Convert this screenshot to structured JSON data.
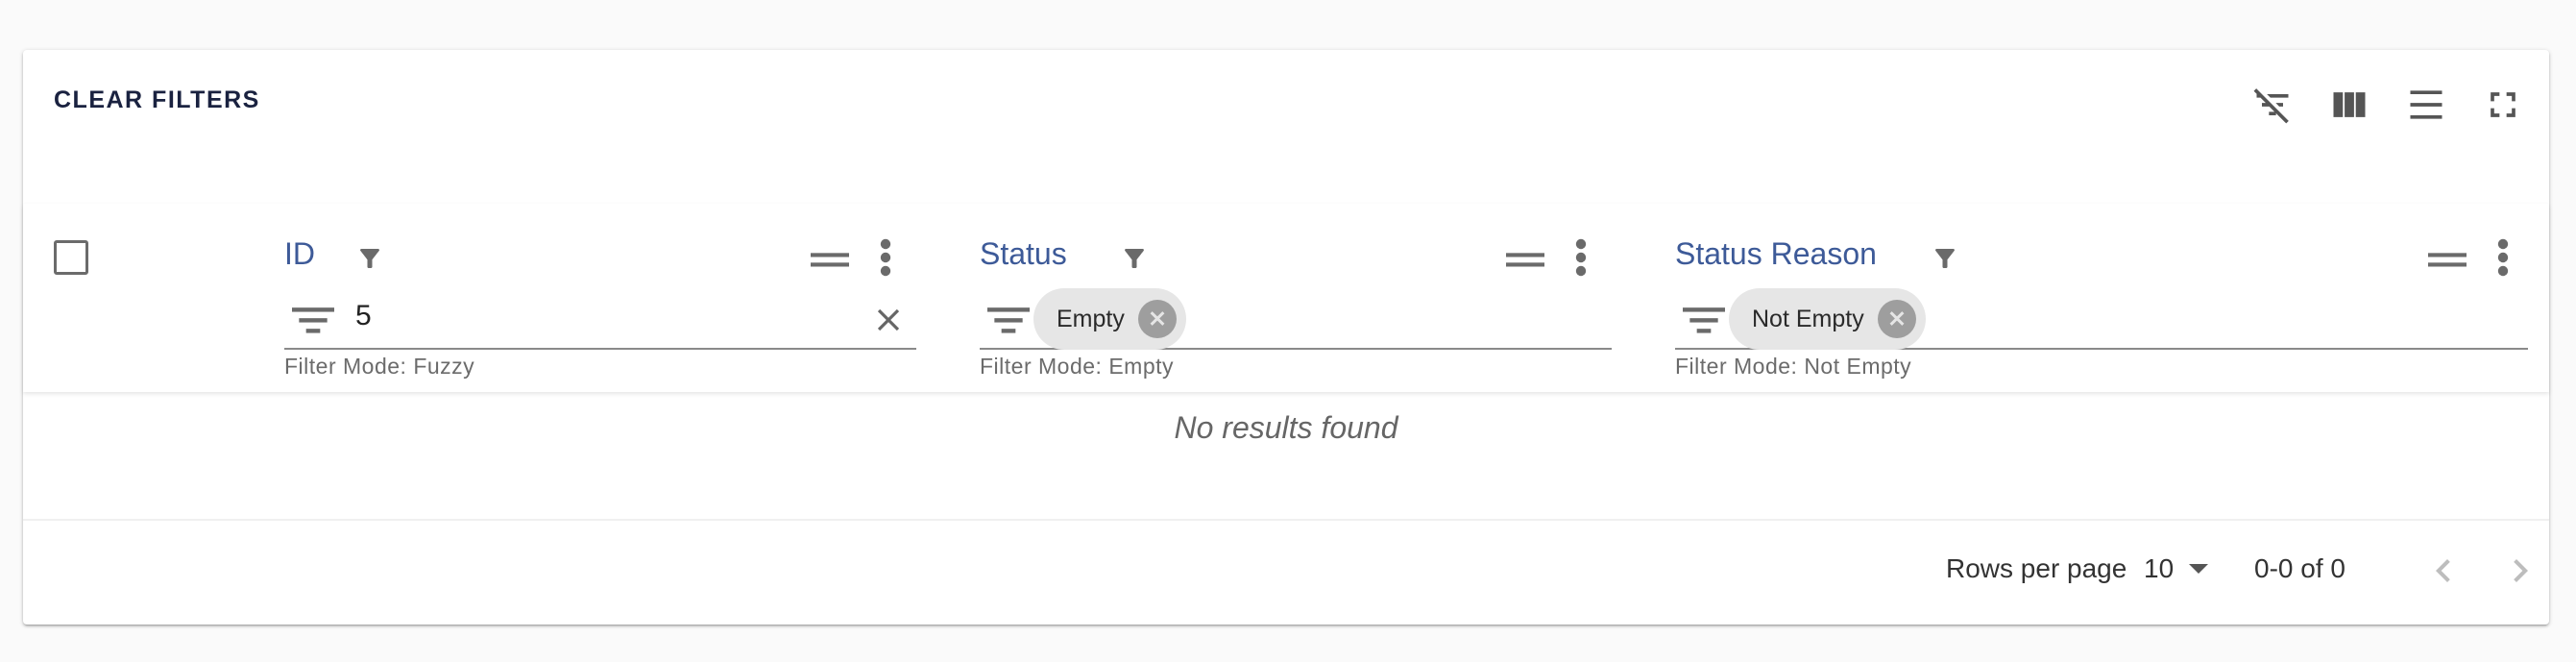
{
  "toolbar": {
    "clear_filters": "CLEAR FILTERS",
    "icons": [
      "filter-off-icon",
      "view-column-icon",
      "density-icon",
      "fullscreen-icon"
    ]
  },
  "columns": [
    {
      "title": "ID",
      "filter_value": "5",
      "filter_mode": "Filter Mode: Fuzzy"
    },
    {
      "title": "Status",
      "chip": "Empty",
      "filter_mode": "Filter Mode: Empty"
    },
    {
      "title": "Status Reason",
      "chip": "Not Empty",
      "filter_mode": "Filter Mode: Not Empty"
    }
  ],
  "body": {
    "empty_message": "No results found"
  },
  "footer": {
    "rows_per_page_label": "Rows per page",
    "rows_per_page_value": "10",
    "range": "0-0 of 0"
  },
  "colors": {
    "header_text": "#3d5a98",
    "clear_filters": "#1a2240"
  }
}
